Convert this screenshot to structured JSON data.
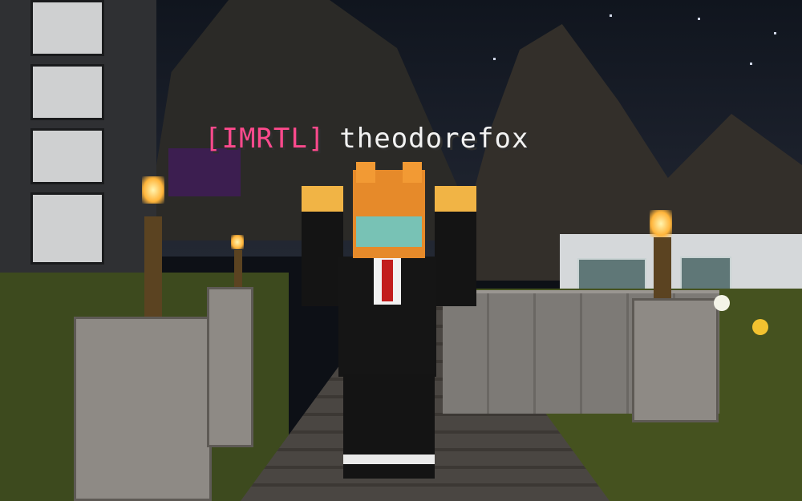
{
  "nameplate": {
    "prefix": "[IMRTL]",
    "username": "theodorefox",
    "prefix_color": "#ff4a8d",
    "username_color": "#f2f2f2"
  },
  "scene": {
    "setting": "night",
    "sky_color": "#10151e",
    "light_source": "torches"
  }
}
